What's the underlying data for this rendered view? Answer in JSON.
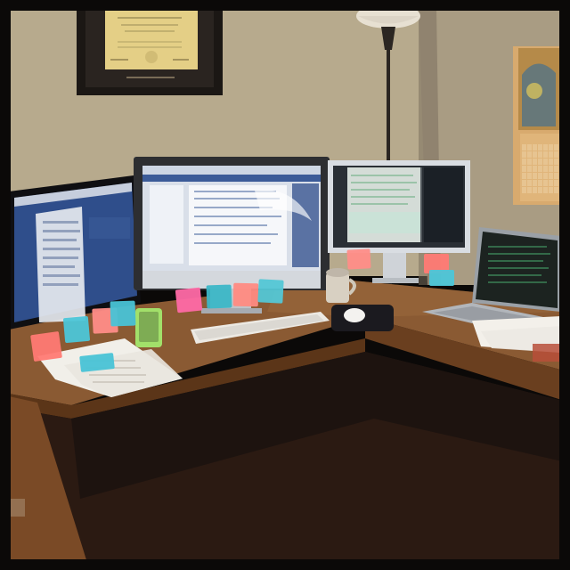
{
  "scene": {
    "kind": "photo",
    "frame_color": "#0b0908",
    "palette": {
      "wall": "#b7aa8d",
      "wall_shadow": "#6f6553",
      "desk_top": "#8a5a33",
      "desk_edge": "#5b3518",
      "desk_dark": "#2b1a12",
      "floor": "#1c1310"
    },
    "diploma": {
      "frame_color": "#1b1714",
      "paper_color": "#e4cf86"
    },
    "lamp": {
      "shade_color": "#e7e0d2",
      "pole_color": "#2b2622"
    },
    "calendar": {
      "color": "#e0b57a"
    },
    "monitors": [
      {
        "name": "left-monitor",
        "screen_color": "#2f4e8b"
      },
      {
        "name": "center-imac",
        "screen_color": "#d9dfe9"
      },
      {
        "name": "right-monitor",
        "screen_color": "#2a2f35"
      },
      {
        "name": "laptop",
        "screen_color": "#1c2320"
      }
    ],
    "sticky_note_colors": [
      "#ff7a74",
      "#4cc6d8",
      "#ff8d88",
      "#49c3d6",
      "#ff6aa7",
      "#3cb7c7",
      "#ff8b82",
      "#53c7d5"
    ],
    "mug_color": "#d8d0c2",
    "mousepad_color": "#1b1a1f",
    "keyboard_color": "#ece9e3",
    "phone_color": "#a2e06a"
  }
}
